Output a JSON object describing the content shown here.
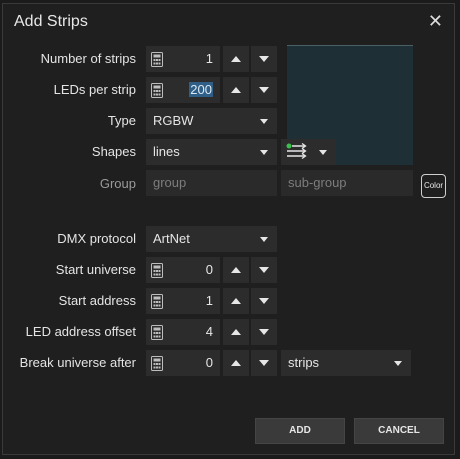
{
  "dialog": {
    "title": "Add Strips",
    "close_symbol": "✕"
  },
  "labels": {
    "number_of_strips": "Number of strips",
    "leds_per_strip": "LEDs per strip",
    "type": "Type",
    "shapes": "Shapes",
    "group": "Group",
    "dmx_protocol": "DMX protocol",
    "start_universe": "Start universe",
    "start_address": "Start address",
    "led_address_offset": "LED address offset",
    "break_universe_after": "Break universe after"
  },
  "values": {
    "number_of_strips": "1",
    "leds_per_strip": "200",
    "type": "RGBW",
    "shapes": "lines",
    "dmx_protocol": "ArtNet",
    "start_universe": "0",
    "start_address": "1",
    "led_address_offset": "4",
    "break_universe_after": "0",
    "break_unit": "strips"
  },
  "placeholders": {
    "group": "group",
    "sub_group": "sub-group"
  },
  "buttons": {
    "color": "Color",
    "add": "ADD",
    "cancel": "CANCEL"
  },
  "icons": {
    "calculator": "calculator-icon",
    "spin_up": "triangle-up-icon",
    "spin_down": "triangle-down-icon",
    "shape_picker": "shape-lines-icon"
  },
  "colors": {
    "preview_bg": "#1e3036",
    "selection": "#2f5f87",
    "shape_dot": "#38c24a"
  }
}
